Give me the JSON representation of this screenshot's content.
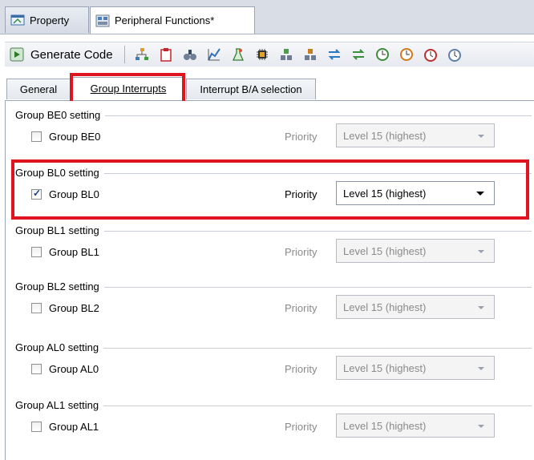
{
  "doc_tabs": [
    {
      "label": "Property",
      "icon": "property-icon"
    },
    {
      "label": "Peripheral Functions*",
      "icon": "peripheral-functions-icon"
    }
  ],
  "toolbar": {
    "generate_code_label": "Generate Code",
    "icons": [
      "generate-code-icon",
      "tree-icon",
      "clipboard-icon",
      "binoculars-icon",
      "chart-icon",
      "flask-icon",
      "chip-icon",
      "connect-icon",
      "connect-alt-icon",
      "transfer-icon",
      "transfer-alt-icon",
      "clock-icon",
      "clock-alt-icon",
      "timer-icon",
      "timer-alt-icon"
    ]
  },
  "inner_tabs": [
    "General",
    "Group Interrupts",
    "Interrupt B/A selection"
  ],
  "priority_label": "Priority",
  "groups": [
    {
      "title": "Group BE0 setting",
      "checkbox_label": "Group BE0",
      "checked": false,
      "priority": "Level 15 (highest)",
      "enabled": false
    },
    {
      "title": "Group BL0 setting",
      "checkbox_label": "Group BL0",
      "checked": true,
      "priority": "Level 15 (highest)",
      "enabled": true
    },
    {
      "title": "Group BL1 setting",
      "checkbox_label": "Group BL1",
      "checked": false,
      "priority": "Level 15 (highest)",
      "enabled": false
    },
    {
      "title": "Group BL2 setting",
      "checkbox_label": "Group BL2",
      "checked": false,
      "priority": "Level 15 (highest)",
      "enabled": false
    },
    {
      "title": "Group AL0 setting",
      "checkbox_label": "Group AL0",
      "checked": false,
      "priority": "Level 15 (highest)",
      "enabled": false
    },
    {
      "title": "Group AL1 setting",
      "checkbox_label": "Group AL1",
      "checked": false,
      "priority": "Level 15 (highest)",
      "enabled": false
    }
  ],
  "colors": {
    "highlight": "#e0141e",
    "tab_strip": "#d9dde6",
    "disabled_text": "#8a8a8a"
  }
}
